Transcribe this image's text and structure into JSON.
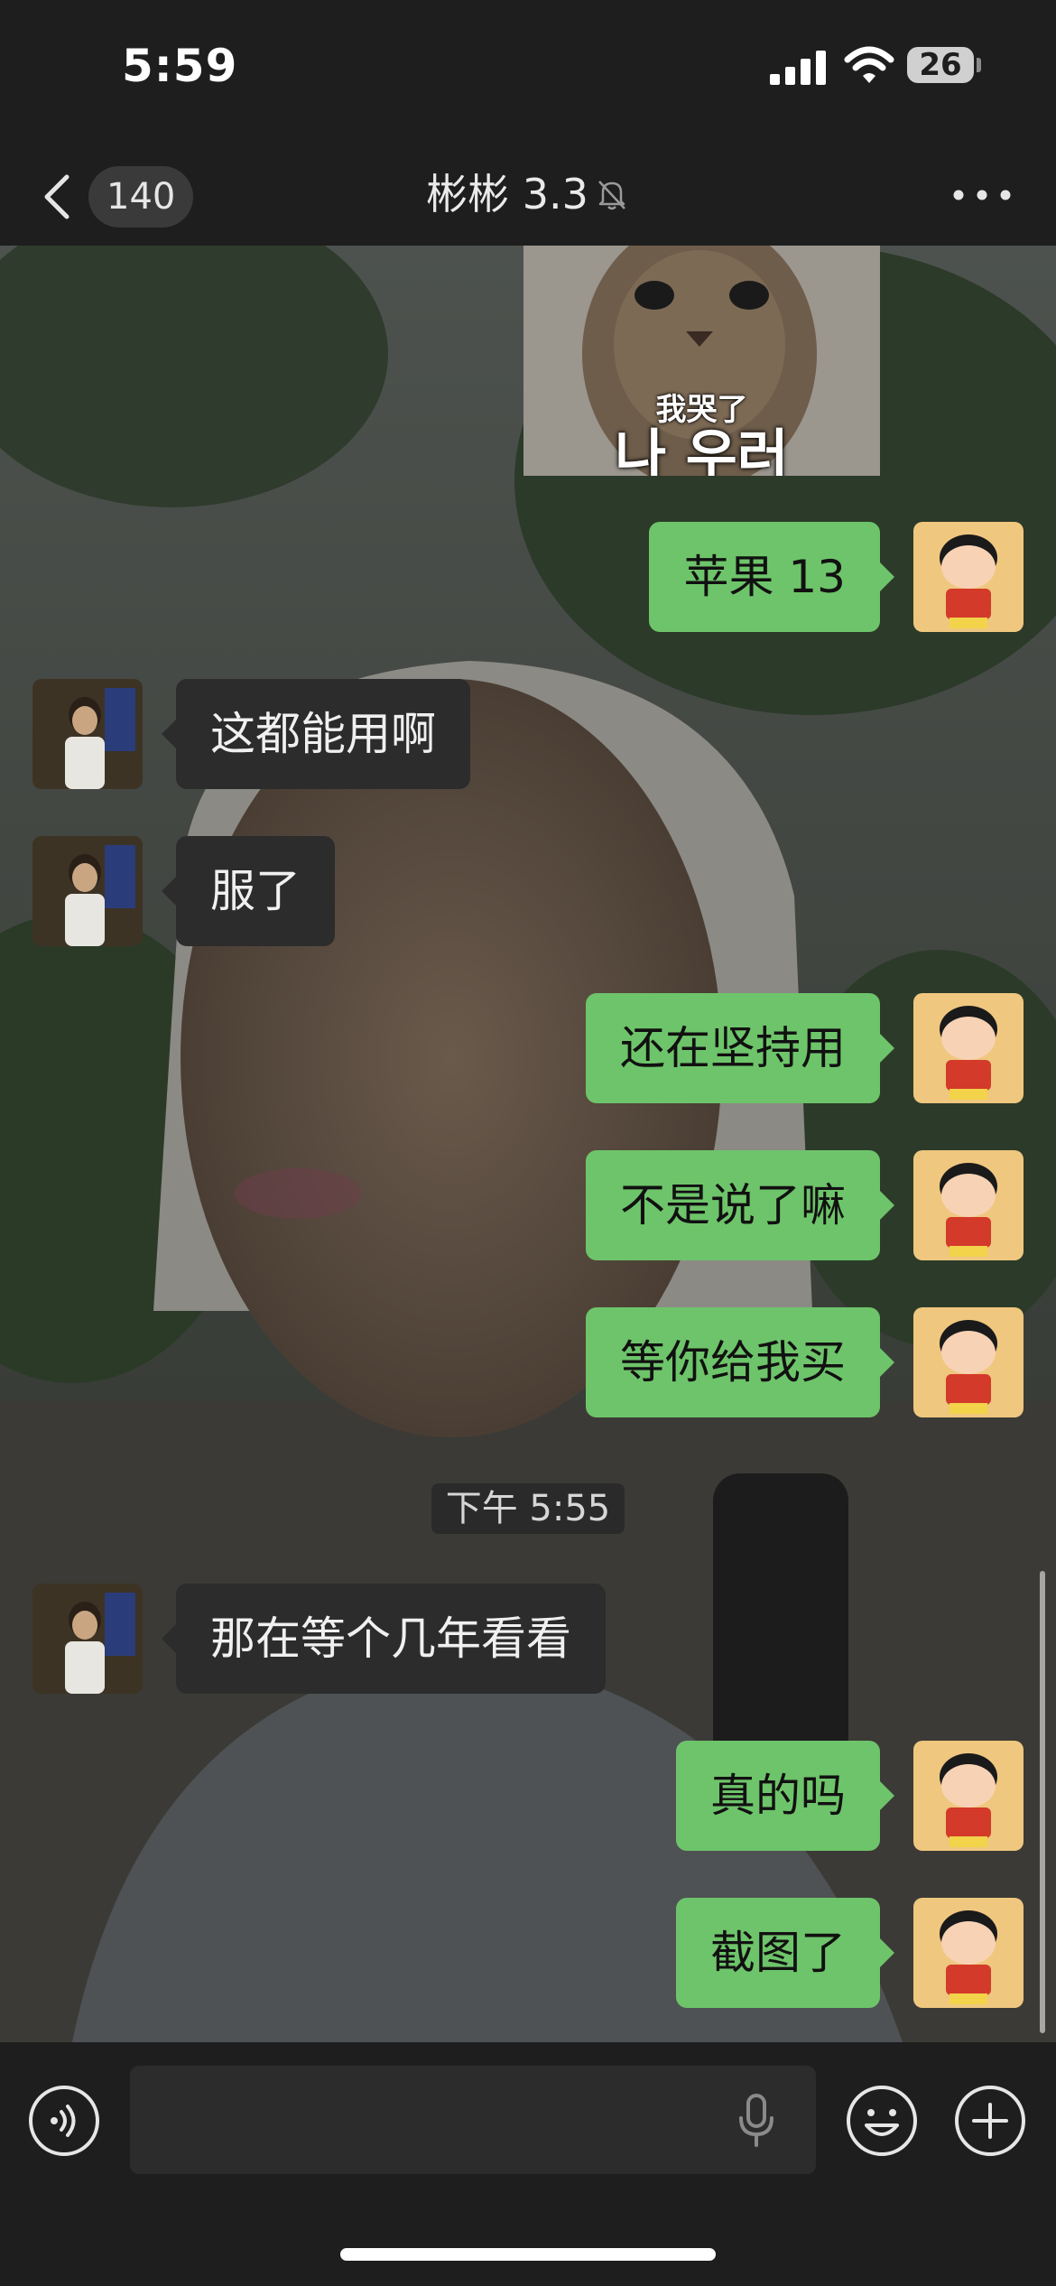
{
  "status_bar": {
    "time": "5:59",
    "battery": "26"
  },
  "nav": {
    "unread_count": "140",
    "title": "彬彬 3.3"
  },
  "sticker": {
    "caption_cn": "我哭了",
    "caption_kr": "나 우러"
  },
  "messages": [
    {
      "side": "out",
      "text": "苹果 13"
    },
    {
      "side": "in",
      "text": "这都能用啊"
    },
    {
      "side": "in",
      "text": "服了"
    },
    {
      "side": "out",
      "text": "还在坚持用"
    },
    {
      "side": "out",
      "text": "不是说了嘛"
    },
    {
      "side": "out",
      "text": "等你给我买"
    },
    {
      "side": "in",
      "text": "那在等个几年看看"
    },
    {
      "side": "out",
      "text": "真的吗"
    },
    {
      "side": "out",
      "text": "截图了"
    }
  ],
  "timestamp": "下午 5:55",
  "input": {
    "placeholder": ""
  },
  "colors": {
    "outgoing_bubble": "#6ec46a",
    "incoming_bubble": "#2c2c2c",
    "background": "#1e1e1e"
  },
  "icons": [
    "signal-icon",
    "wifi-icon",
    "battery-icon",
    "back-chevron-icon",
    "mute-bell-icon",
    "more-icon",
    "voice-toggle-icon",
    "microphone-icon",
    "emoji-icon",
    "plus-icon"
  ]
}
